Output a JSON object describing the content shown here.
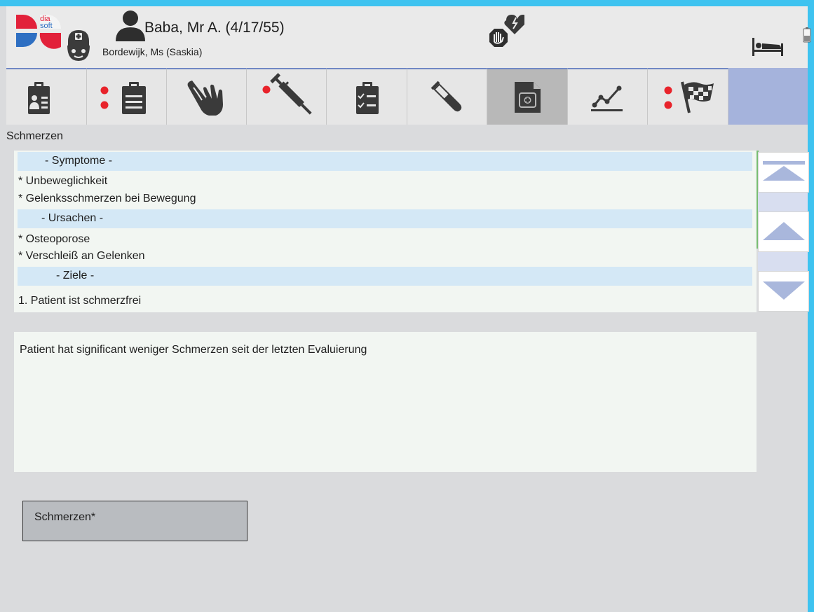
{
  "header": {
    "logo_text_top": "dia",
    "logo_text_bottom": "soft",
    "patient_name": "Baba, Mr A. (4/17/55)",
    "nurse_name": "Bordewijk, Ms (Saskia)",
    "icons": [
      "nurse-icon",
      "patient-icon",
      "allergy-alert-icon",
      "bed-icon",
      "battery-icon"
    ]
  },
  "toolbar": {
    "tabs": [
      {
        "id": "patient-card",
        "icon": "clipboard-person-icon",
        "has_alert": false,
        "active": false
      },
      {
        "id": "notes",
        "icon": "clipboard-lines-icon",
        "has_alert": true,
        "active": false
      },
      {
        "id": "wound-care",
        "icon": "hand-icon",
        "has_alert": false,
        "active": false
      },
      {
        "id": "medication",
        "icon": "syringe-icon",
        "has_alert": true,
        "active": false
      },
      {
        "id": "checklist",
        "icon": "clipboard-checklist-icon",
        "has_alert": false,
        "active": false
      },
      {
        "id": "lab",
        "icon": "test-tube-icon",
        "has_alert": false,
        "active": false
      },
      {
        "id": "care-plan",
        "icon": "medical-file-icon",
        "has_alert": false,
        "active": true
      },
      {
        "id": "vitals-chart",
        "icon": "line-chart-icon",
        "has_alert": false,
        "active": false
      },
      {
        "id": "goals",
        "icon": "checkered-flag-icon",
        "has_alert": true,
        "active": false
      }
    ],
    "alert_color": "#e8232b"
  },
  "section_title": "Schmerzen",
  "careplan": {
    "symptoms_header": "- Symptome -",
    "symptoms": [
      "* Unbeweglichkeit",
      "* Gelenksschmerzen bei Bewegung"
    ],
    "causes_header": "- Ursachen -",
    "causes": [
      "* Osteoporose",
      "* Verschleiß an Gelenken"
    ],
    "goals_header": "- Ziele -",
    "goals": [
      "1. Patient ist schmerzfrei"
    ]
  },
  "scroll": {
    "top_icon": "scroll-to-top-icon",
    "up_icon": "scroll-up-icon",
    "down_icon": "scroll-down-icon"
  },
  "evaluation_text": "Patient hat significant weniger Schmerzen seit der letzten Evaluierung",
  "action_button_label": "Schmerzen*",
  "colors": {
    "frame": "#3ec3f0",
    "toolbar_bg": "#a5b3dc",
    "band": "#d4e8f6",
    "scroll_arrow": "#a9b7dc",
    "scroll_thumb": "#79bd73"
  }
}
